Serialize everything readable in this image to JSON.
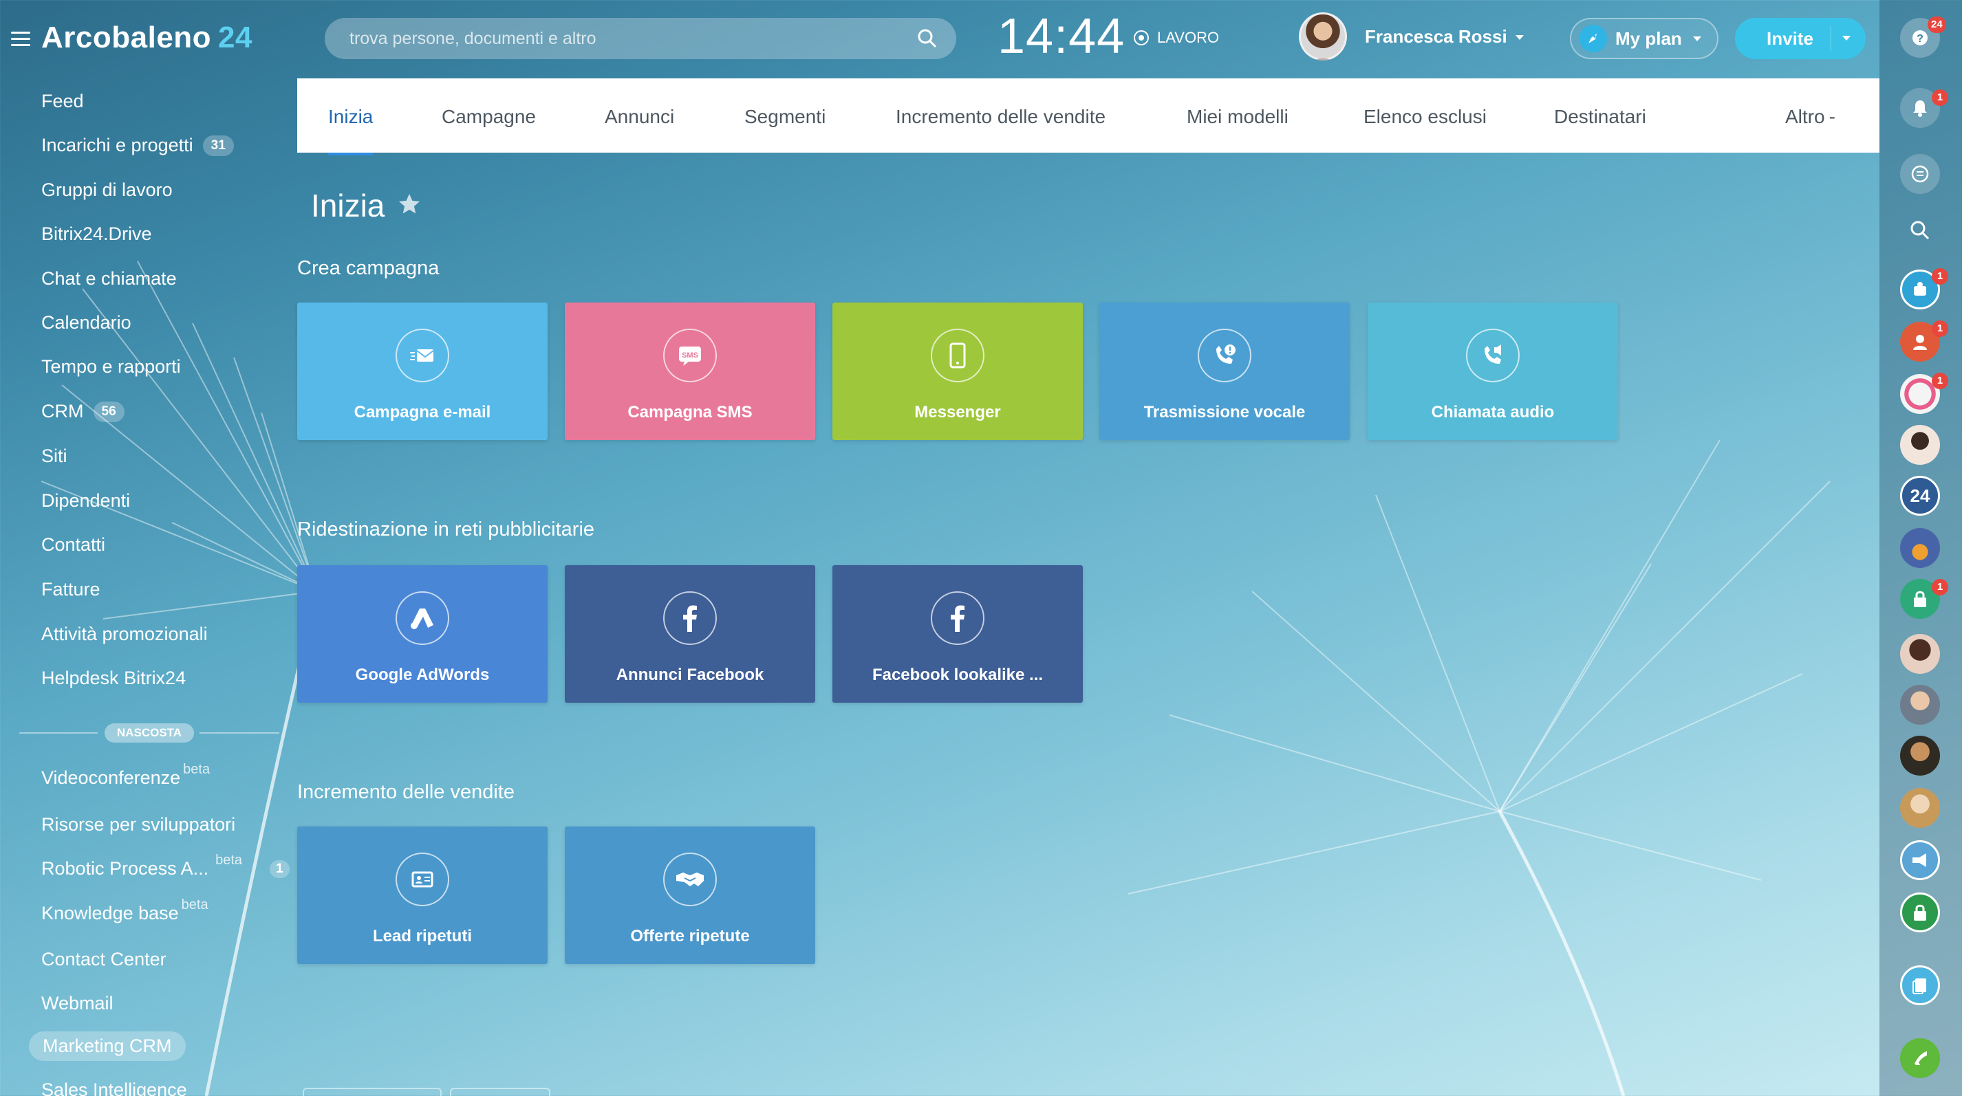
{
  "app": {
    "name": "Arcobaleno",
    "number": "24"
  },
  "search": {
    "placeholder": "trova persone, documenti e altro"
  },
  "clock": {
    "time": "14:44",
    "status": "LAVORO"
  },
  "user": {
    "name": "Francesca Rossi"
  },
  "plan": {
    "label": "My plan"
  },
  "invite": {
    "label": "Invite"
  },
  "sidebar": {
    "items": [
      {
        "label": "Feed"
      },
      {
        "label": "Incarichi e progetti",
        "badge": "31"
      },
      {
        "label": "Gruppi di lavoro"
      },
      {
        "label": "Bitrix24.Drive"
      },
      {
        "label": "Chat e chiamate"
      },
      {
        "label": "Calendario"
      },
      {
        "label": "Tempo e rapporti"
      },
      {
        "label": "CRM",
        "badge": "56"
      },
      {
        "label": "Siti"
      },
      {
        "label": "Dipendenti"
      },
      {
        "label": "Contatti"
      },
      {
        "label": "Fatture"
      },
      {
        "label": "Attività promozionali"
      },
      {
        "label": "Helpdesk Bitrix24"
      }
    ],
    "hidden_label": "NASCOSTA",
    "hidden_items": [
      {
        "label": "Videoconferenze",
        "sup": "beta"
      },
      {
        "label": "Risorse per sviluppatori"
      },
      {
        "label": "Robotic Process A...",
        "sup": "beta",
        "badge": "1"
      },
      {
        "label": "Knowledge base",
        "sup": "beta"
      },
      {
        "label": "Contact Center"
      },
      {
        "label": "Webmail"
      },
      {
        "label": "Marketing CRM"
      },
      {
        "label": "Sales Intelligence"
      }
    ]
  },
  "tabs": [
    {
      "label": "Inizia"
    },
    {
      "label": "Campagne"
    },
    {
      "label": "Annunci"
    },
    {
      "label": "Segmenti"
    },
    {
      "label": "Incremento delle vendite"
    },
    {
      "label": "Miei modelli"
    },
    {
      "label": "Elenco esclusi"
    },
    {
      "label": "Destinatari"
    },
    {
      "label": "Altro"
    }
  ],
  "page": {
    "title": "Inizia"
  },
  "sections": [
    {
      "title": "Crea campagna",
      "tiles": [
        {
          "label": "Campagna e-mail",
          "icon": "email-icon",
          "color": "#57b9e8"
        },
        {
          "label": "Campagna SMS",
          "icon": "sms-icon",
          "color": "#e8789a"
        },
        {
          "label": "Messenger",
          "icon": "mobile-icon",
          "color": "#9fc73b"
        },
        {
          "label": "Trasmissione vocale",
          "icon": "voice-broadcast-icon",
          "color": "#4b9fd2"
        },
        {
          "label": "Chiamata audio",
          "icon": "audio-call-icon",
          "color": "#55bbd7"
        }
      ]
    },
    {
      "title": "Ridestinazione in reti pubblicitarie",
      "tiles": [
        {
          "label": "Google AdWords",
          "icon": "adwords-icon",
          "color": "#4a86d6"
        },
        {
          "label": "Annunci Facebook",
          "icon": "facebook-icon",
          "color": "#3e5e96"
        },
        {
          "label": "Facebook lookalike ...",
          "icon": "facebook-icon",
          "color": "#3e5e96"
        }
      ]
    },
    {
      "title": "Incremento delle vendite",
      "tiles": [
        {
          "label": "Lead ripetuti",
          "icon": "lead-icon",
          "color": "#4a97cc"
        },
        {
          "label": "Offerte ripetute",
          "icon": "handshake-icon",
          "color": "#4a97cc"
        }
      ]
    }
  ],
  "rightbar": {
    "help_badge": "24",
    "notifications_badge": "1",
    "contact_badges": [
      "1",
      "1",
      "1",
      "1"
    ],
    "contact_label": "24"
  }
}
